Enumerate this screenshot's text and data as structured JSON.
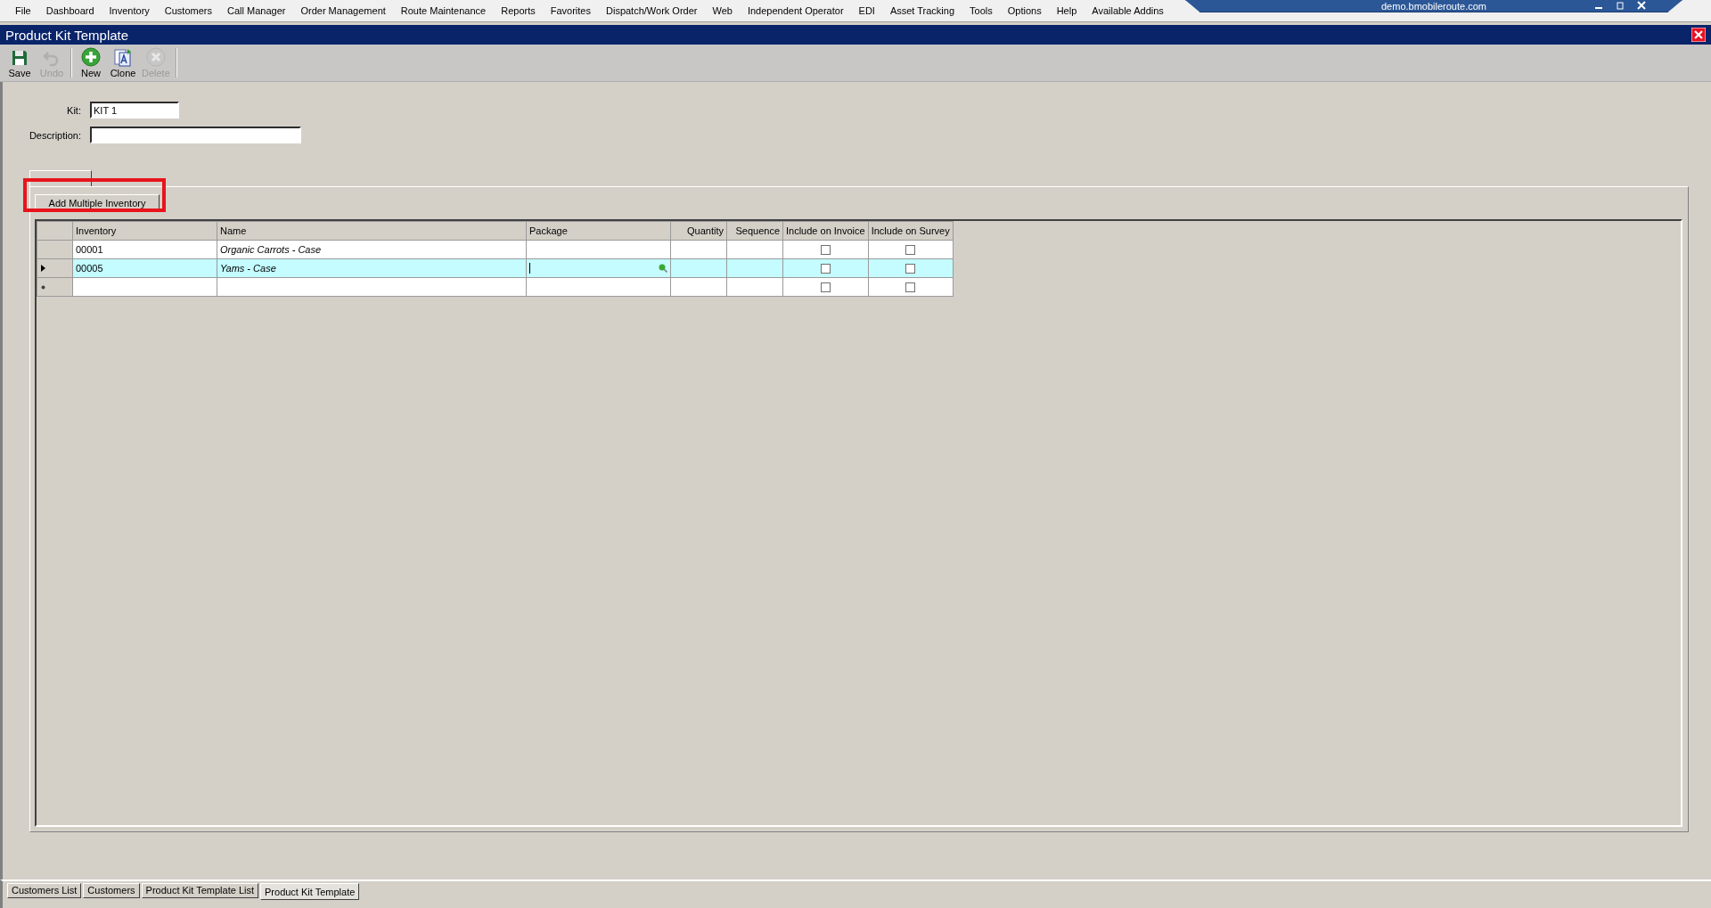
{
  "menu": [
    "File",
    "Dashboard",
    "Inventory",
    "Customers",
    "Call Manager",
    "Order Management",
    "Route Maintenance",
    "Reports",
    "Favorites",
    "Dispatch/Work Order",
    "Web",
    "Independent Operator",
    "EDI",
    "Asset Tracking",
    "Tools",
    "Options",
    "Help",
    "Available Addins"
  ],
  "remote_bar": {
    "host": "demo.bmobileroute.com"
  },
  "window": {
    "title": "Product Kit Template"
  },
  "toolbar": [
    {
      "kind": "save",
      "label": "Save",
      "disabled": false
    },
    {
      "kind": "undo",
      "label": "Undo",
      "disabled": true
    },
    {
      "kind": "new",
      "label": "New",
      "disabled": false
    },
    {
      "kind": "clone",
      "label": "Clone",
      "disabled": false
    },
    {
      "kind": "delete",
      "label": "Delete",
      "disabled": true
    }
  ],
  "form": {
    "fields": [
      {
        "label": "Kit:",
        "value": "KIT 1"
      },
      {
        "label": "Description:"
      }
    ]
  },
  "tabs": [
    {
      "selected": true
    }
  ],
  "add_button": "Add Multiple Inventory",
  "grid": {
    "columns": [
      {
        "label": "Inventory",
        "kind": "text"
      },
      {
        "label": "Name",
        "kind": "italic"
      },
      {
        "label": "Package",
        "kind": "lookup"
      },
      {
        "label": "Quantity",
        "kind": "number"
      },
      {
        "label": "Sequence",
        "kind": "number"
      },
      {
        "label": "Include on Invoice",
        "kind": "check"
      },
      {
        "label": "Include on Survey",
        "kind": "check"
      }
    ],
    "rows": [
      {
        "kind": "item",
        "selected": false,
        "inventory": "00001",
        "name": "Organic Carrots - Case",
        "include_on_invoice": false,
        "include_on_survey": false
      },
      {
        "kind": "item",
        "selected": true,
        "inventory": "00005",
        "name": "Yams - Case",
        "include_on_invoice": false,
        "include_on_survey": false
      },
      {
        "kind": "new",
        "selected": false,
        "include_on_invoice": false,
        "include_on_survey": false
      }
    ]
  },
  "document_tabs": [
    {
      "label": "Customers List",
      "selected": false
    },
    {
      "label": "Customers",
      "selected": false
    },
    {
      "label": "Product Kit Template List",
      "selected": false
    },
    {
      "label": "Product Kit Template",
      "selected": true
    }
  ]
}
